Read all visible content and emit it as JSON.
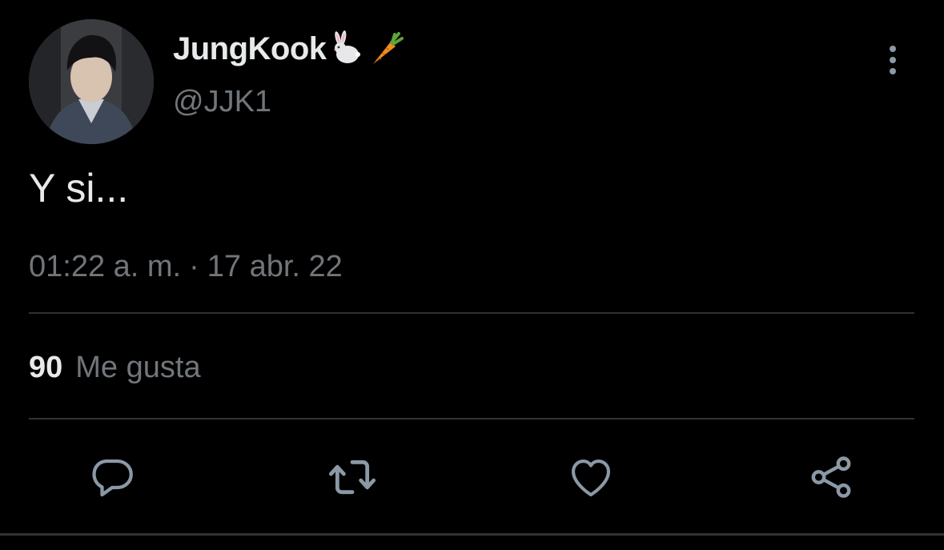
{
  "tweet": {
    "display_name": "JungKook",
    "display_name_emojis": [
      "rabbit-emoji",
      "carrot-emoji"
    ],
    "handle": "@JJK1",
    "text": "Y si...",
    "time": "01:22 a. m.",
    "separator": "·",
    "date": "17 abr. 22",
    "likes_count": "90",
    "likes_label": "Me gusta"
  },
  "actions": [
    {
      "name": "reply",
      "icon": "comment-icon"
    },
    {
      "name": "retweet",
      "icon": "retweet-icon"
    },
    {
      "name": "like",
      "icon": "heart-icon"
    },
    {
      "name": "share",
      "icon": "share-icon"
    }
  ],
  "colors": {
    "background": "#000000",
    "primary_text": "#e7e9ea",
    "secondary_text": "#71767b",
    "divider": "#2f3336",
    "icon": "#8b98a5"
  }
}
